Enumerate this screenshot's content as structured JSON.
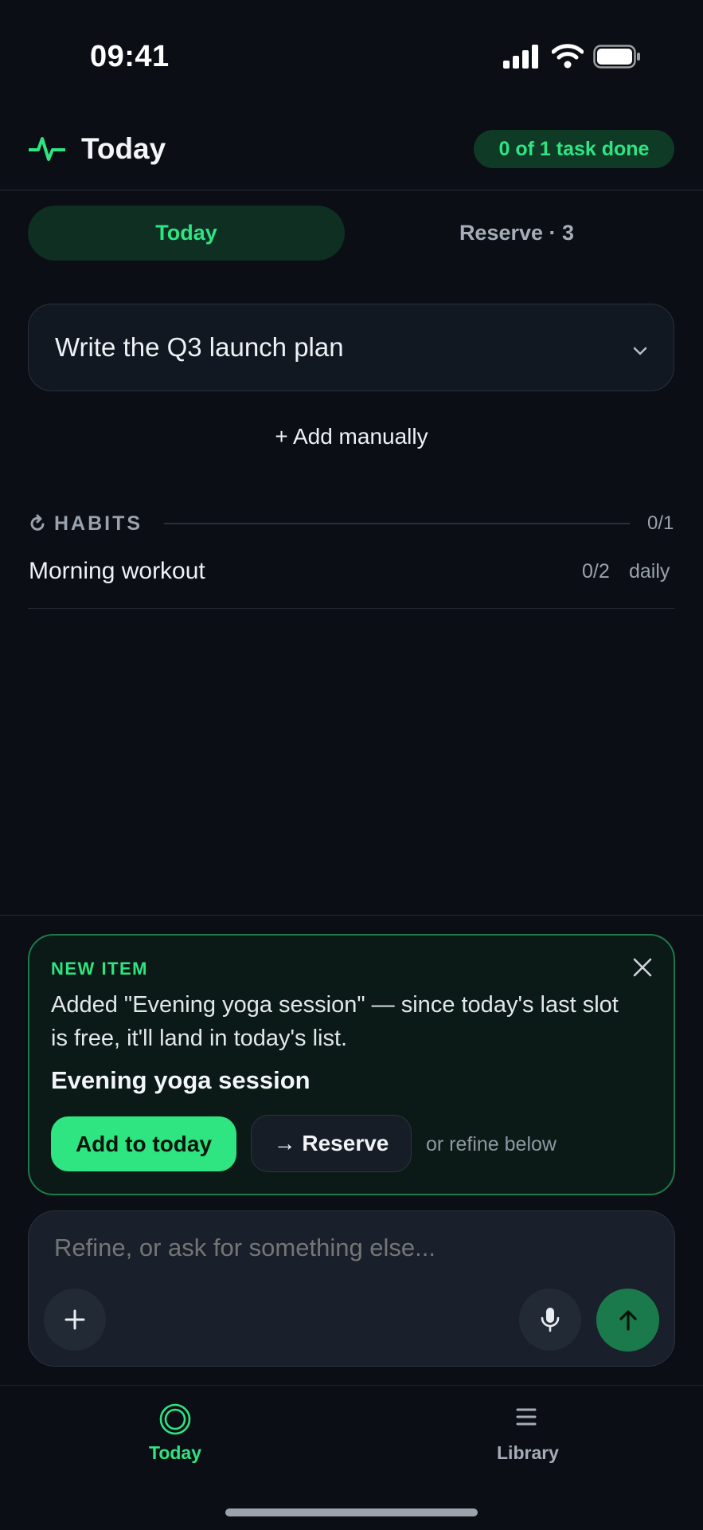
{
  "status_bar": {
    "time": "09:41"
  },
  "header": {
    "title": "Today",
    "progress": "0 of 1 task done",
    "icon": "pulse-icon"
  },
  "tabs": [
    {
      "label": "Today",
      "active": true
    },
    {
      "label": "Reserve · 3",
      "active": false
    }
  ],
  "task": {
    "title": "Write the Q3 launch plan"
  },
  "add_manually_label": "+ Add manually",
  "habits": {
    "label": "HABITS",
    "count": "0/1",
    "items": [
      {
        "name": "Morning workout",
        "progress": "0/2",
        "frequency": "daily"
      }
    ]
  },
  "suggestion": {
    "label": "NEW ITEM",
    "message": "Added \"Evening yoga session\" — since today's last slot is free, it'll land in today's list.",
    "item": "Evening yoga session",
    "primary_button": "Add to today",
    "secondary_button": "→ Reserve",
    "hint": "or refine below"
  },
  "composer": {
    "placeholder": "Refine, or ask for something else..."
  },
  "bottom_nav": [
    {
      "label": "Today",
      "icon": "target-icon",
      "active": true
    },
    {
      "label": "Library",
      "icon": "menu-icon",
      "active": false
    }
  ],
  "colors": {
    "accent": "#2ee582",
    "background": "#0b0e14",
    "card": "#121821"
  }
}
